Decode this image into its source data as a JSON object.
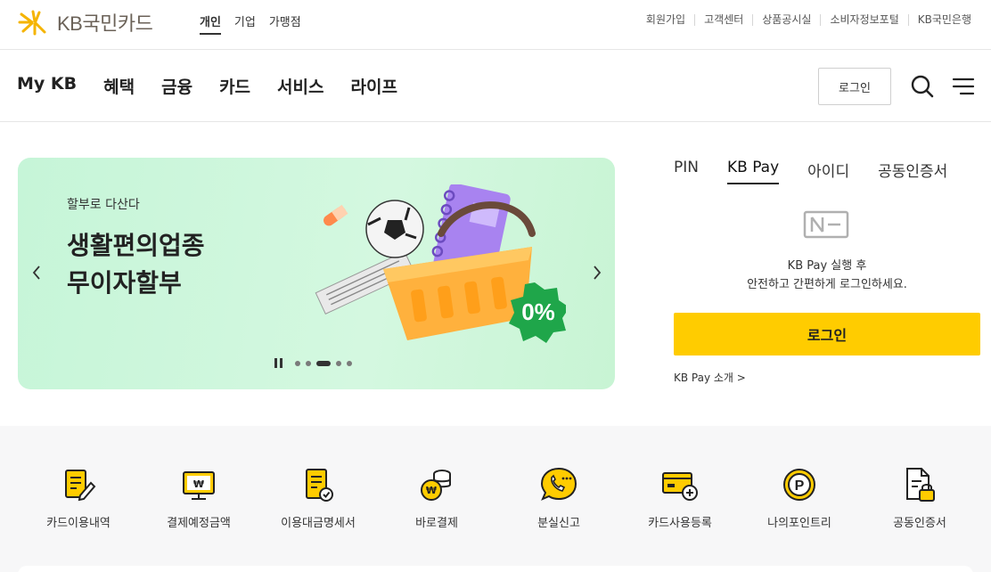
{
  "header": {
    "logo_text": "KB국민카드",
    "segments": [
      {
        "label": "개인",
        "active": true
      },
      {
        "label": "기업",
        "active": false
      },
      {
        "label": "가맹점",
        "active": false
      }
    ],
    "utility_links": [
      "회원가입",
      "고객센터",
      "상품공시실",
      "소비자정보포털",
      "KB국민은행"
    ]
  },
  "gnb": {
    "menu": [
      "My KB",
      "혜택",
      "금융",
      "카드",
      "서비스",
      "라이프"
    ],
    "login_label": "로그인",
    "search_icon": "search-icon",
    "menu_icon": "hamburger-menu-icon"
  },
  "banner": {
    "subtitle": "할부로 다산다",
    "title_line1": "생활편의업종",
    "title_line2": "무이자할부",
    "badge": "0%",
    "slide_count": 5,
    "active_slide": 3,
    "background": "#c6f5d8"
  },
  "login_panel": {
    "tabs": [
      {
        "label": "PIN",
        "active": false
      },
      {
        "label": "KB Pay",
        "active": true
      },
      {
        "label": "아이디",
        "active": false
      },
      {
        "label": "공동인증서",
        "active": false
      }
    ],
    "message_line1": "KB Pay 실행 후",
    "message_line2": "안전하고 간편하게 로그인하세요.",
    "login_button": "로그인",
    "intro_link": "KB Pay 소개 >",
    "accent": "#ffcc00"
  },
  "quick_menu": [
    {
      "label": "카드이용내역",
      "icon": "card-usage-history-icon"
    },
    {
      "label": "결제예정금액",
      "icon": "payment-due-monitor-icon"
    },
    {
      "label": "이용대금명세서",
      "icon": "statement-document-icon"
    },
    {
      "label": "바로결제",
      "icon": "instant-payment-coins-icon"
    },
    {
      "label": "분실신고",
      "icon": "lost-report-phone-icon"
    },
    {
      "label": "카드사용등록",
      "icon": "card-register-plus-icon"
    },
    {
      "label": "나의포인트리",
      "icon": "point-p-coin-icon"
    },
    {
      "label": "공동인증서",
      "icon": "certificate-lock-icon"
    }
  ]
}
